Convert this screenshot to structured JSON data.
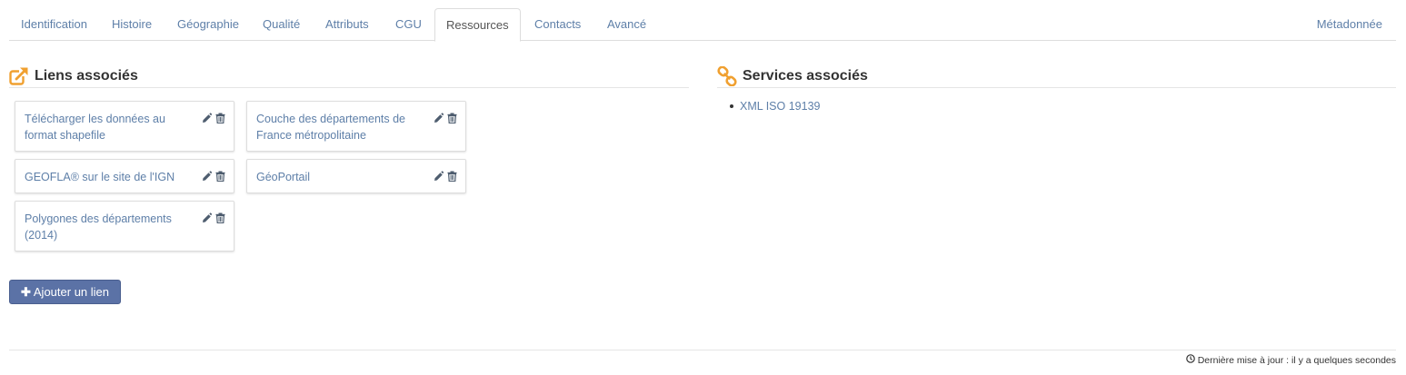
{
  "tabs": [
    {
      "label": "Identification"
    },
    {
      "label": "Histoire"
    },
    {
      "label": "Géographie"
    },
    {
      "label": "Qualité"
    },
    {
      "label": "Attributs"
    },
    {
      "label": "CGU"
    },
    {
      "label": "Ressources",
      "active": true
    },
    {
      "label": "Contacts"
    },
    {
      "label": "Avancé"
    }
  ],
  "metadata_tab": "Métadonnée",
  "links_section": {
    "title": "Liens associés",
    "icon": "external-link-icon",
    "items": [
      {
        "label": "Télécharger les données au format shapefile"
      },
      {
        "label": "Couche des départements de France métropolitaine"
      },
      {
        "label": "GEOFLA® sur le site de l'IGN"
      },
      {
        "label": "GéoPortail"
      },
      {
        "label": "Polygones des départements (2014)"
      }
    ]
  },
  "services_section": {
    "title": "Services associés",
    "icon": "chain-link-icon",
    "items": [
      {
        "label": "XML ISO 19139"
      }
    ]
  },
  "add_link_button": "Ajouter un lien",
  "footer": {
    "text": "Dernière mise à jour : il y a quelques secondes",
    "icon": "clock-icon"
  },
  "colors": {
    "link": "#5e7fa8",
    "accent_orange": "#f0a030",
    "button": "#5b72a6"
  }
}
